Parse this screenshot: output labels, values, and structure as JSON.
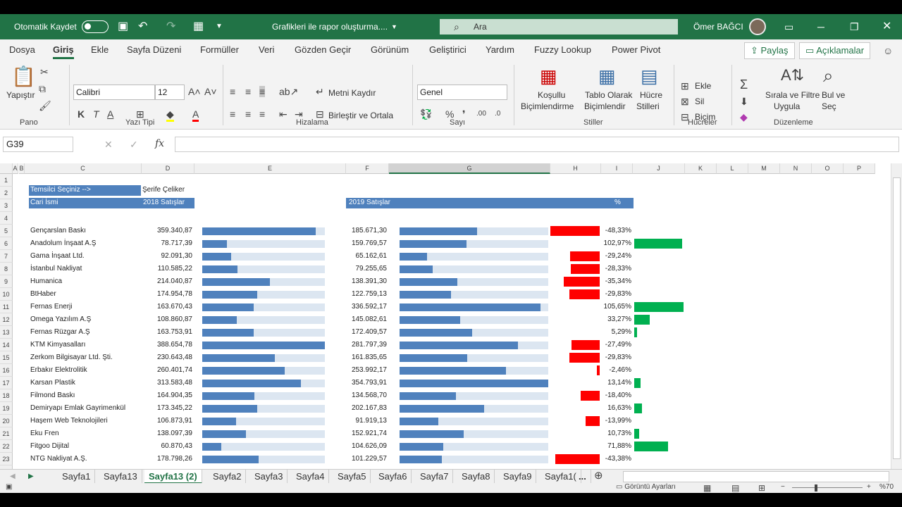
{
  "titlebar": {
    "autosave": "Otomatik Kaydet",
    "doc_title": "Grafikleri ile rapor oluşturma....",
    "search_placeholder": "Ara",
    "user": "Ömer BAĞCI"
  },
  "ribbon_tabs": [
    "Dosya",
    "Giriş",
    "Ekle",
    "Sayfa Düzeni",
    "Formüller",
    "Veri",
    "Gözden Geçir",
    "Görünüm",
    "Geliştirici",
    "Yardım",
    "Fuzzy Lookup",
    "Power Pivot"
  ],
  "share": "Paylaş",
  "comments": "Açıklamalar",
  "ribbon": {
    "paste": "Yapıştır",
    "font_name": "Calibri",
    "font_size": "12",
    "wrap_text": "Metni Kaydır",
    "merge_center": "Birleştir ve Ortala",
    "number_format": "Genel",
    "cond_format": [
      "Koşullu",
      "Biçimlendirme"
    ],
    "format_table": [
      "Tablo Olarak",
      "Biçimlendir"
    ],
    "cell_styles": [
      "Hücre",
      "Stilleri"
    ],
    "insert": "Ekle",
    "delete": "Sil",
    "format": "Biçim",
    "sort_filter": [
      "Sırala ve Filtre",
      "Uygula"
    ],
    "find_select": [
      "Bul ve",
      "Seç"
    ],
    "groups": [
      "Pano",
      "Yazı Tipi",
      "Hizalama",
      "Sayı",
      "Stiller",
      "Hücreler",
      "Düzenleme"
    ]
  },
  "formula_bar": {
    "name_box": "G39",
    "fx": "fx",
    "content": ""
  },
  "columns": [
    "A",
    "B",
    "C",
    "D",
    "E",
    "F",
    "G",
    "H",
    "I",
    "J",
    "K",
    "L",
    "M",
    "N",
    "O",
    "P"
  ],
  "rows": [
    "1",
    "2",
    "3",
    "4",
    "5",
    "6",
    "7",
    "8",
    "9",
    "10",
    "11",
    "12",
    "13",
    "14",
    "15",
    "16",
    "17",
    "18",
    "19",
    "20",
    "21",
    "22",
    "23",
    "24"
  ],
  "report": {
    "select_label": "Temsilci Seçiniz -->",
    "selected_rep": "Şerife Çeliker",
    "headers": {
      "name": "Cari İsmi",
      "y2018": "2018 Satışlar",
      "y2019": "2019 Satışlar",
      "pct": "%"
    },
    "records": [
      {
        "name": "Gençarslan Baskı",
        "y2018": "359.340,87",
        "y2019": "185.671,30",
        "pct": "-48,33%",
        "v2018": 359340.87,
        "v2019": 185671.3,
        "p": -48.33
      },
      {
        "name": "Anadolum İnşaat A.Ş",
        "y2018": "78.717,39",
        "y2019": "159.769,57",
        "pct": "102,97%",
        "v2018": 78717.39,
        "v2019": 159769.57,
        "p": 102.97
      },
      {
        "name": "Gama İnşaat Ltd.",
        "y2018": "92.091,30",
        "y2019": "65.162,61",
        "pct": "-29,24%",
        "v2018": 92091.3,
        "v2019": 65162.61,
        "p": -29.24
      },
      {
        "name": "İstanbul Nakliyat",
        "y2018": "110.585,22",
        "y2019": "79.255,65",
        "pct": "-28,33%",
        "v2018": 110585.22,
        "v2019": 79255.65,
        "p": -28.33
      },
      {
        "name": "Humanica",
        "y2018": "214.040,87",
        "y2019": "138.391,30",
        "pct": "-35,34%",
        "v2018": 214040.87,
        "v2019": 138391.3,
        "p": -35.34
      },
      {
        "name": "BtHaber",
        "y2018": "174.954,78",
        "y2019": "122.759,13",
        "pct": "-29,83%",
        "v2018": 174954.78,
        "v2019": 122759.13,
        "p": -29.83
      },
      {
        "name": "Fernas Enerji",
        "y2018": "163.670,43",
        "y2019": "336.592,17",
        "pct": "105,65%",
        "v2018": 163670.43,
        "v2019": 336592.17,
        "p": 105.65
      },
      {
        "name": "Omega Yazılım A.Ş",
        "y2018": "108.860,87",
        "y2019": "145.082,61",
        "pct": "33,27%",
        "v2018": 108860.87,
        "v2019": 145082.61,
        "p": 33.27
      },
      {
        "name": "Fernas Rüzgar A.Ş",
        "y2018": "163.753,91",
        "y2019": "172.409,57",
        "pct": "5,29%",
        "v2018": 163753.91,
        "v2019": 172409.57,
        "p": 5.29
      },
      {
        "name": "KTM Kimyasalları",
        "y2018": "388.654,78",
        "y2019": "281.797,39",
        "pct": "-27,49%",
        "v2018": 388654.78,
        "v2019": 281797.39,
        "p": -27.49
      },
      {
        "name": "Zerkom Bilgisayar Ltd. Şti.",
        "y2018": "230.643,48",
        "y2019": "161.835,65",
        "pct": "-29,83%",
        "v2018": 230643.48,
        "v2019": 161835.65,
        "p": -29.83
      },
      {
        "name": "Erbakır Elektrolitik",
        "y2018": "260.401,74",
        "y2019": "253.992,17",
        "pct": "-2,46%",
        "v2018": 260401.74,
        "v2019": 253992.17,
        "p": -2.46
      },
      {
        "name": "Karsan Plastik",
        "y2018": "313.583,48",
        "y2019": "354.793,91",
        "pct": "13,14%",
        "v2018": 313583.48,
        "v2019": 354793.91,
        "p": 13.14
      },
      {
        "name": "Filmond Baskı",
        "y2018": "164.904,35",
        "y2019": "134.568,70",
        "pct": "-18,40%",
        "v2018": 164904.35,
        "v2019": 134568.7,
        "p": -18.4
      },
      {
        "name": "Demiryapı Emlak Gayrimenkül",
        "y2018": "173.345,22",
        "y2019": "202.167,83",
        "pct": "16,63%",
        "v2018": 173345.22,
        "v2019": 202167.83,
        "p": 16.63
      },
      {
        "name": "Haşem Web Teknolojileri",
        "y2018": "106.873,91",
        "y2019": "91.919,13",
        "pct": "-13,99%",
        "v2018": 106873.91,
        "v2019": 91919.13,
        "p": -13.99
      },
      {
        "name": "Eku Fren",
        "y2018": "138.097,39",
        "y2019": "152.921,74",
        "pct": "10,73%",
        "v2018": 138097.39,
        "v2019": 152921.74,
        "p": 10.73
      },
      {
        "name": "Fitgoo Dijital",
        "y2018": "60.870,43",
        "y2019": "104.626,09",
        "pct": "71,88%",
        "v2018": 60870.43,
        "v2019": 104626.09,
        "p": 71.88
      },
      {
        "name": "NTG Nakliyat A.Ş.",
        "y2018": "178.798,26",
        "y2019": "101.229,57",
        "pct": "-43,38%",
        "v2018": 178798.26,
        "v2019": 101229.57,
        "p": -43.38
      }
    ]
  },
  "sheet_tabs": [
    "Sayfa1",
    "Sayfa13",
    "Sayfa13 (2)",
    "Sayfa2",
    "Sayfa3",
    "Sayfa4",
    "Sayfa5",
    "Sayfa6",
    "Sayfa7",
    "Sayfa8",
    "Sayfa9",
    "Sayfa1("
  ],
  "active_sheet": "Sayfa13 (2)",
  "more_tabs": "...",
  "status": {
    "display_settings": "Görüntü Ayarları",
    "zoom": "%70"
  },
  "colors": {
    "accent": "#217346",
    "bar_blue": "#4f81bd",
    "bar_bg": "#dce6f1",
    "negative": "#ff0000",
    "positive": "#00b050"
  }
}
